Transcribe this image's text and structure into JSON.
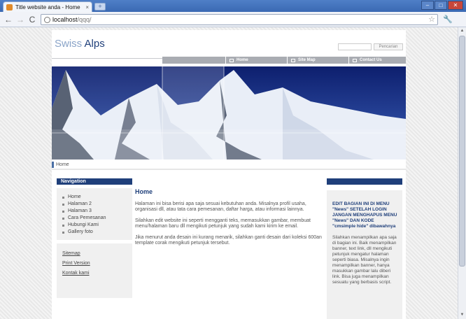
{
  "browser": {
    "tab_title": "Title website anda - Home",
    "tab_close": "×",
    "new_tab": "+",
    "url_host": "localhost",
    "url_path": "/qqq/",
    "back": "←",
    "forward": "→",
    "reload": "C",
    "star": "☆",
    "wrench": "🔧"
  },
  "site": {
    "logo_part1": "Swiss",
    "logo_part2": "Alps",
    "search_button": "Pencarian",
    "menu": [
      {
        "label": "Home"
      },
      {
        "label": "Site Map"
      },
      {
        "label": "Contact Us"
      }
    ],
    "breadcrumb": "Home",
    "nav_heading": "Navigation",
    "nav_items": [
      {
        "label": "Home"
      },
      {
        "label": "Halaman 2"
      },
      {
        "label": "Halaman 3"
      },
      {
        "label": "Cara Pemesanan"
      },
      {
        "label": "Hubungi Kami"
      },
      {
        "label": "Gallery foto"
      }
    ],
    "footer_links": [
      {
        "label": "Sitemap"
      },
      {
        "label": "Print Version"
      },
      {
        "label": "Kontak kami"
      }
    ],
    "content": {
      "title": "Home",
      "paragraphs": [
        "Halaman ini bisa berisi apa saja sesuai kebutuhan anda. Misalnya profil usaha, organisasi dll, atau tata cara pemesanan, daftar harga, atau informasi lainnya.",
        "Silahkan edit website ini seperti mengganti teks, memasukkan gambar, membuat menu/halaman baru dll mengikuti petunjuk yang sudah kami kirim ke email.",
        "Jika menurut anda desain ini kurang menarik, silahkan ganti desain dari koleksi 600an template corak mengikuti petunjuk tersebut."
      ]
    },
    "right": {
      "bold_text": "EDIT BAGIAN INI DI MENU \"News\" SETELAH LOGIN\nJANGAN MENGHAPUS MENU \"News\" DAN KODE \"cmsimple hide\" dibawahnya",
      "text": "Silahkan menampilkan apa saja di bagian ini. Baik menampilkan banner, text link, dll mengikuti petunjuk mengatur halaman seperti biasa. Misalnya ingin menampilkan banner, hanya masukkan gambar lalu diberi link. Bisa juga menampilkan sesuatu yang berbasis script."
    }
  }
}
